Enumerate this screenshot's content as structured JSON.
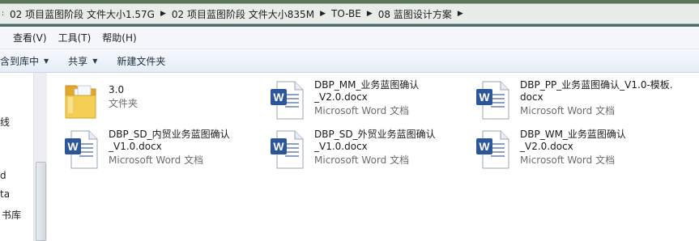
{
  "address": {
    "crumbs": [
      "02 项目蓝图阶段 文件大小1.57G",
      "02 项目蓝图阶段 文件大小835M",
      "TO-BE",
      "08 蓝图设计方案"
    ]
  },
  "menu": {
    "items": [
      "查看(V)",
      "工具(T)",
      "帮助(H)"
    ]
  },
  "toolbar": {
    "include_library": "含到库中",
    "share": "共享",
    "new_folder": "新建文件夹"
  },
  "left_pane": {
    "items": [
      "线",
      "d",
      "ta",
      "书库"
    ]
  },
  "files": [
    {
      "name": "3.0",
      "type": "文件夹",
      "icon": "folder-icon"
    },
    {
      "name": "DBP_MM_业务蓝图确认\n_V2.0.docx",
      "type": "Microsoft Word 文档",
      "icon": "word-document-icon"
    },
    {
      "name": "DBP_PP_业务蓝图确认_V1.0-模板.\ndocx",
      "type": "Microsoft Word 文档",
      "icon": "word-document-icon"
    },
    {
      "name": "DBP_SD_内贸业务蓝图确认\n_V1.0.docx",
      "type": "Microsoft Word 文档",
      "icon": "word-document-icon"
    },
    {
      "name": "DBP_SD_外贸业务蓝图确认\n_V1.0.docx",
      "type": "Microsoft Word 文档",
      "icon": "word-document-icon"
    },
    {
      "name": "DBP_WM_业务蓝图确认\n_V2.0.docx",
      "type": "Microsoft Word 文档",
      "icon": "word-document-icon"
    }
  ],
  "colors": {
    "word_blue": "#2b579a",
    "folder_yellow": "#f2c94c"
  }
}
